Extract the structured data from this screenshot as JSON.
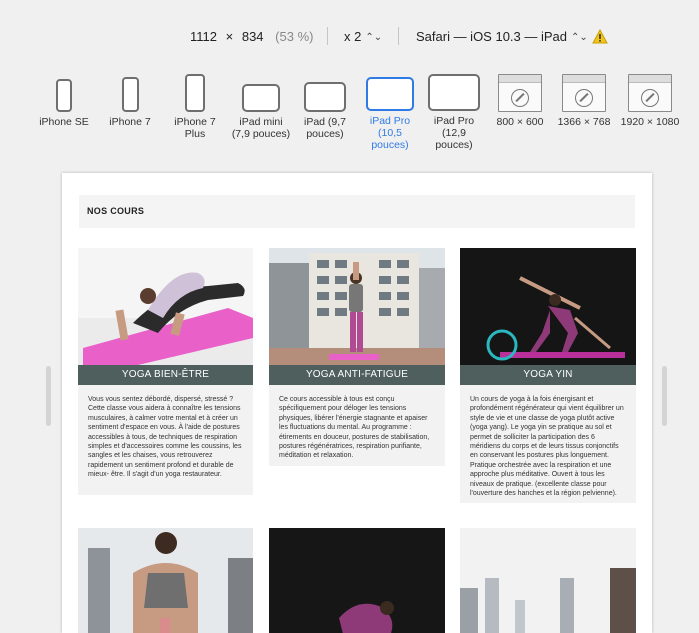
{
  "toolbar": {
    "width": "1112",
    "times": "×",
    "height": "834",
    "percent": "(53 %)",
    "scale": "x 2",
    "browser": "Safari — iOS 10.3 — iPad",
    "warning_icon": "warning-triangle-icon"
  },
  "devices": [
    {
      "label": "iPhone SE",
      "icon": "phone-icon",
      "active": false
    },
    {
      "label": "iPhone 7",
      "icon": "phone-icon",
      "active": false
    },
    {
      "label": "iPhone 7 Plus",
      "icon": "phone-icon",
      "active": false
    },
    {
      "label": "iPad mini (7,9 pouces)",
      "icon": "tablet-icon",
      "active": false
    },
    {
      "label": "iPad (9,7 pouces)",
      "icon": "tablet-icon",
      "active": false
    },
    {
      "label": "iPad Pro (10,5 pouces)",
      "icon": "tablet-icon",
      "active": true
    },
    {
      "label": "iPad Pro (12,9 pouces)",
      "icon": "tablet-icon",
      "active": false
    },
    {
      "label": "800 × 600",
      "icon": "safari-window-icon",
      "active": false
    },
    {
      "label": "1366 × 768",
      "icon": "safari-window-icon",
      "active": false
    },
    {
      "label": "1920 × 1080",
      "icon": "safari-window-icon",
      "active": false
    }
  ],
  "page": {
    "section_title": "NOS COURS",
    "cards": [
      {
        "title": "YOGA BIEN-ÊTRE",
        "description": "Vous vous sentez débordé, dispersé, stressé ? Cette classe vous aidera à connaître les tensions musculaires, à calmer votre mental et à créer un sentiment d'espace en vous. À l'aide de postures accessibles à tous, de techniques de respiration simples et d'accessoires comme les coussins, les sangles et les chaises, vous retrouverez rapidement un sentiment profond et durable de mieux- être. Il s'agit d'un yoga restaurateur."
      },
      {
        "title": "YOGA ANTI-FATIGUE",
        "description": "Ce cours accessible à tous est conçu spécifiquement pour déloger les tensions physiques, libérer l'énergie stagnante et apaiser les fluctuations du mental. Au programme : étirements en douceur, postures de stabilisation, postures régénératrices, respiration purifiante, méditation et relaxation."
      },
      {
        "title": "YOGA YIN",
        "description": "Un cours de yoga à la fois énergisant et profondément régénérateur qui vient équilibrer un style de vie et une classe de yoga plutôt active (yoga yang). Le yoga yin se pratique au sol et permet de solliciter la participation des 6 méridiens du corps et de leurs tissus conjonctifs en conservant les postures plus longuement. Pratique orchestrée avec la respiration et une approche plus méditative. Ouvert à tous les niveaux de pratique. (excellente classe pour l'ouverture des hanches et la région pelvienne)."
      }
    ]
  },
  "colors": {
    "accent": "#2f7ae5",
    "card_title_bg": "#4e5f5e",
    "mat_pink": "#e860c8"
  }
}
